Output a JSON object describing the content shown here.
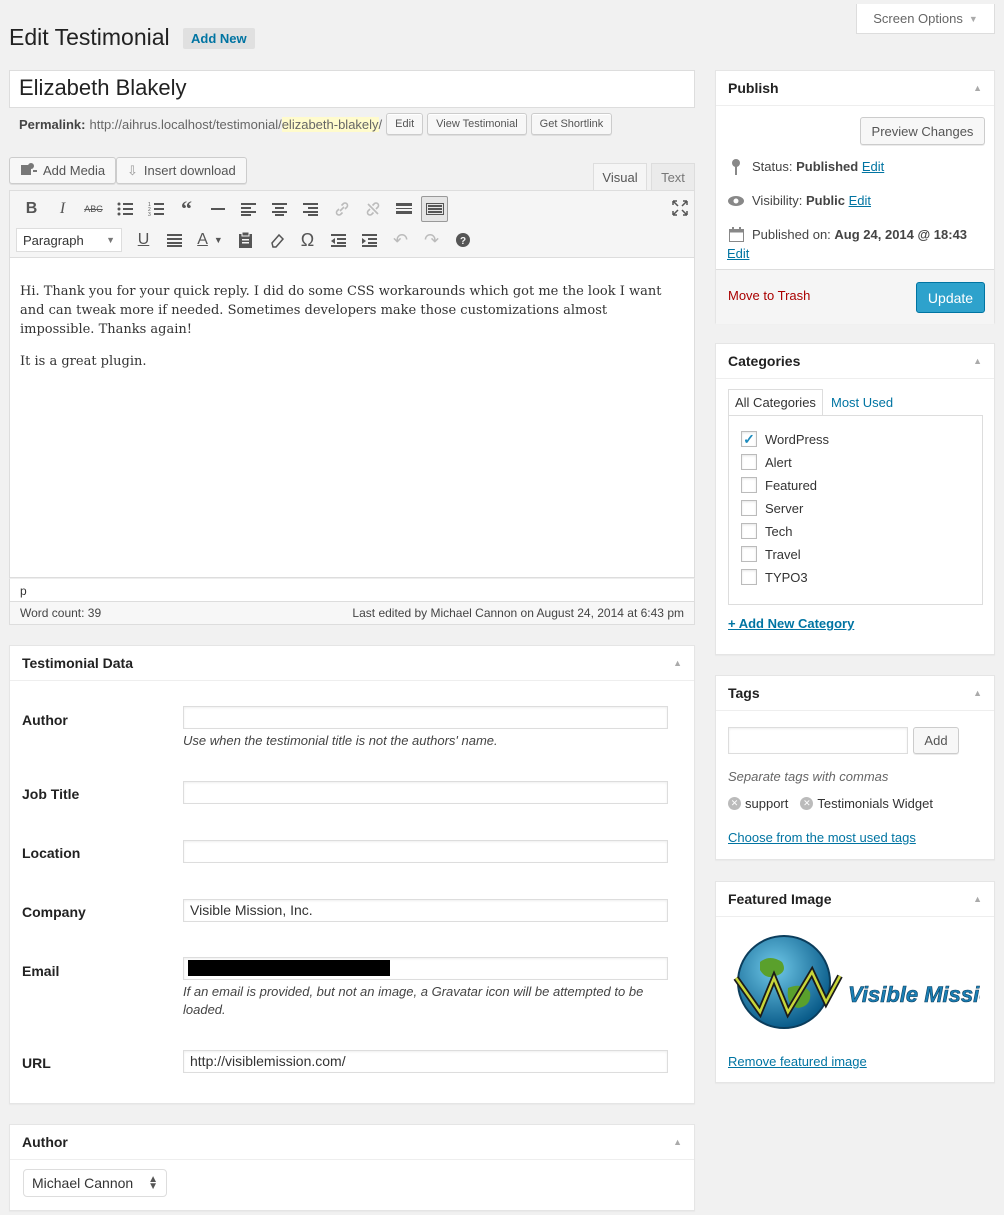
{
  "header": {
    "title": "Edit Testimonial",
    "add_new": "Add New",
    "screen_options": "Screen Options"
  },
  "post": {
    "title": "Elizabeth Blakely",
    "permalink_label": "Permalink:",
    "permalink_base": "http://aihrus.localhost/testimonial/",
    "permalink_slug": "elizabeth-blakely",
    "permalink_trail": "/",
    "edit_btn": "Edit",
    "view_btn": "View Testimonial",
    "shortlink_btn": "Get Shortlink"
  },
  "editor": {
    "add_media": "Add Media",
    "insert_download": "Insert download",
    "tab_visual": "Visual",
    "tab_text": "Text",
    "format": "Paragraph",
    "paragraphs": [
      "Hi. Thank you for your quick reply. I did do some CSS workarounds which got me the look I want and can tweak more if needed. Sometimes developers make those customizations almost impossible. Thanks again!",
      "It is a great plugin."
    ],
    "path": "p",
    "word_count": "Word count: 39",
    "last_edited": "Last edited by Michael Cannon on August 24, 2014 at 6:43 pm"
  },
  "testimonial_data": {
    "heading": "Testimonial Data",
    "author_label": "Author",
    "author_value": "",
    "author_desc": "Use when the testimonial title is not the authors' name.",
    "job_label": "Job Title",
    "job_value": "",
    "location_label": "Location",
    "location_value": "",
    "company_label": "Company",
    "company_value": "Visible Mission, Inc.",
    "email_label": "Email",
    "email_desc": "If an email is provided, but not an image, a Gravatar icon will be attempted to be loaded.",
    "url_label": "URL",
    "url_value": "http://visiblemission.com/"
  },
  "author_box": {
    "heading": "Author",
    "selected": "Michael Cannon"
  },
  "publish": {
    "heading": "Publish",
    "preview": "Preview Changes",
    "status_label": "Status:",
    "status_value": "Published",
    "visibility_label": "Visibility:",
    "visibility_value": "Public",
    "published_label": "Published on:",
    "published_value": "Aug 24, 2014 @ 18:43",
    "edit": "Edit",
    "trash": "Move to Trash",
    "update": "Update"
  },
  "categories": {
    "heading": "Categories",
    "tab_all": "All Categories",
    "tab_used": "Most Used",
    "items": [
      {
        "label": "WordPress",
        "checked": true
      },
      {
        "label": "Alert",
        "checked": false
      },
      {
        "label": "Featured",
        "checked": false
      },
      {
        "label": "Server",
        "checked": false
      },
      {
        "label": "Tech",
        "checked": false
      },
      {
        "label": "Travel",
        "checked": false
      },
      {
        "label": "TYPO3",
        "checked": false
      }
    ],
    "add_new": "+ Add New Category"
  },
  "tags": {
    "heading": "Tags",
    "add": "Add",
    "hint": "Separate tags with commas",
    "list": [
      "support",
      "Testimonials Widget"
    ],
    "choose": "Choose from the most used tags"
  },
  "featured_image": {
    "heading": "Featured Image",
    "logo_text": "Visible Mission",
    "remove": "Remove featured image"
  },
  "colors": {
    "link": "#0074a2",
    "update_button": "#2ea2cc",
    "trash": "#aa0000"
  }
}
